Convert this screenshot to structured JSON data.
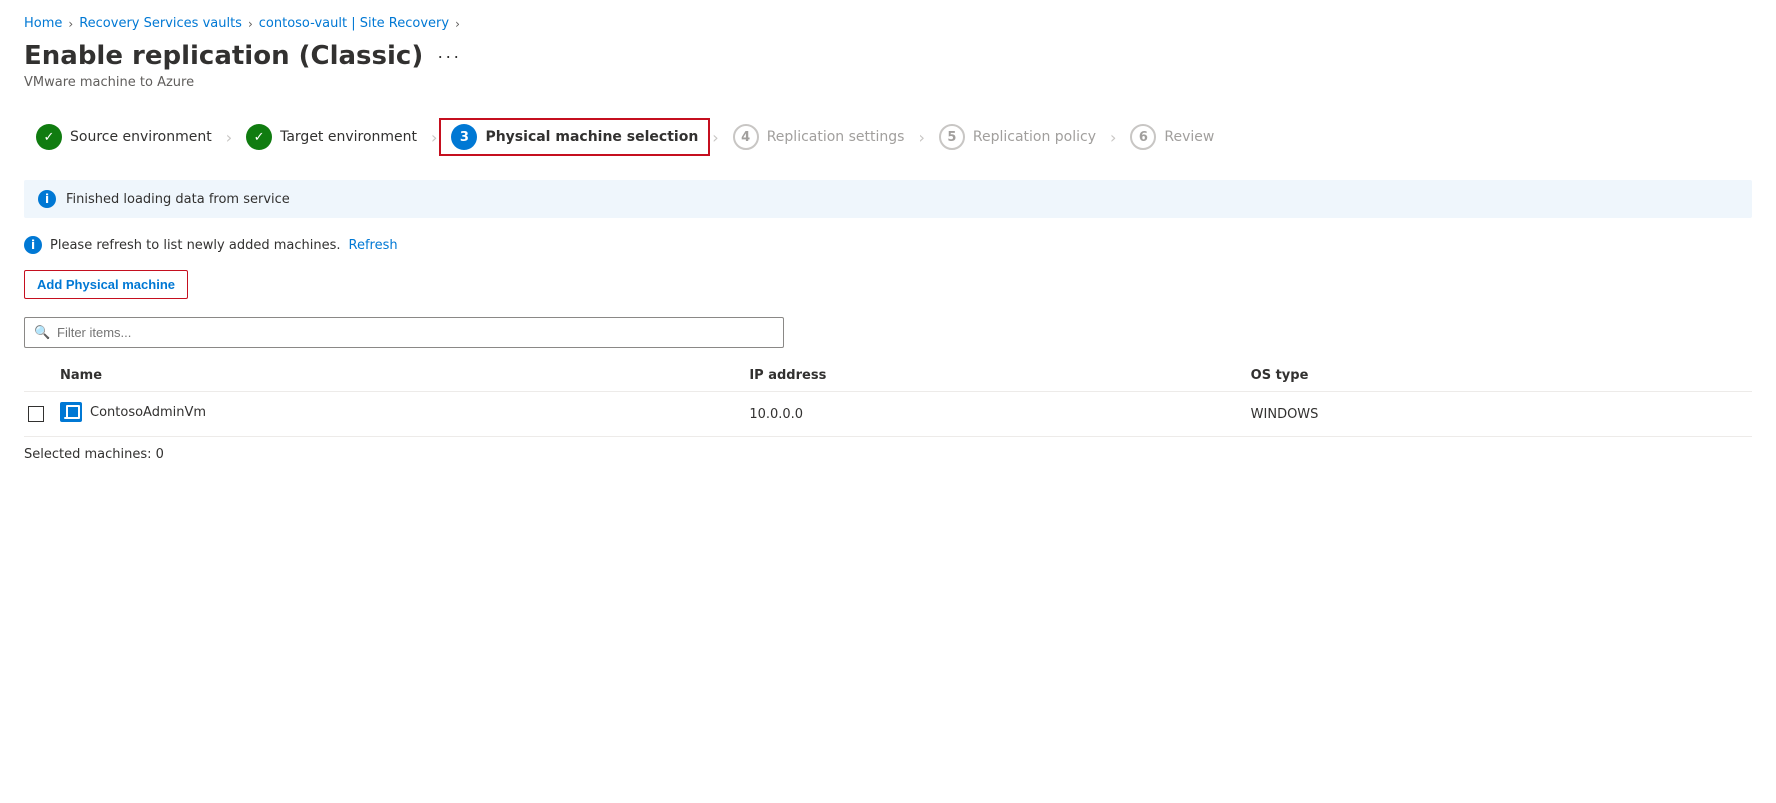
{
  "breadcrumb": {
    "home": "Home",
    "recovery": "Recovery Services vaults",
    "vault": "contoso-vault | Site Recovery",
    "sep": "›"
  },
  "page": {
    "title": "Enable replication (Classic)",
    "subtitle": "VMware machine to Azure",
    "more_label": "···"
  },
  "steps": [
    {
      "id": "source",
      "number": "✓",
      "label": "Source environment",
      "state": "completed"
    },
    {
      "id": "target",
      "number": "✓",
      "label": "Target environment",
      "state": "completed"
    },
    {
      "id": "physical",
      "number": "3",
      "label": "Physical machine selection",
      "state": "active"
    },
    {
      "id": "replication-settings",
      "number": "4",
      "label": "Replication settings",
      "state": "inactive"
    },
    {
      "id": "replication-policy",
      "number": "5",
      "label": "Replication policy",
      "state": "inactive"
    },
    {
      "id": "review",
      "number": "6",
      "label": "Review",
      "state": "inactive"
    }
  ],
  "info_banner": {
    "text": "Finished loading data from service"
  },
  "refresh_notice": {
    "text": "Please refresh to list newly added machines.",
    "link_text": "Refresh"
  },
  "add_button": {
    "label": "Add Physical machine"
  },
  "filter": {
    "placeholder": "Filter items..."
  },
  "table": {
    "columns": [
      "Name",
      "IP address",
      "OS type"
    ],
    "rows": [
      {
        "name": "ContosoAdminVm",
        "ip": "10.0.0.0",
        "os": "WINDOWS"
      }
    ]
  },
  "selected_count_label": "Selected machines: 0"
}
